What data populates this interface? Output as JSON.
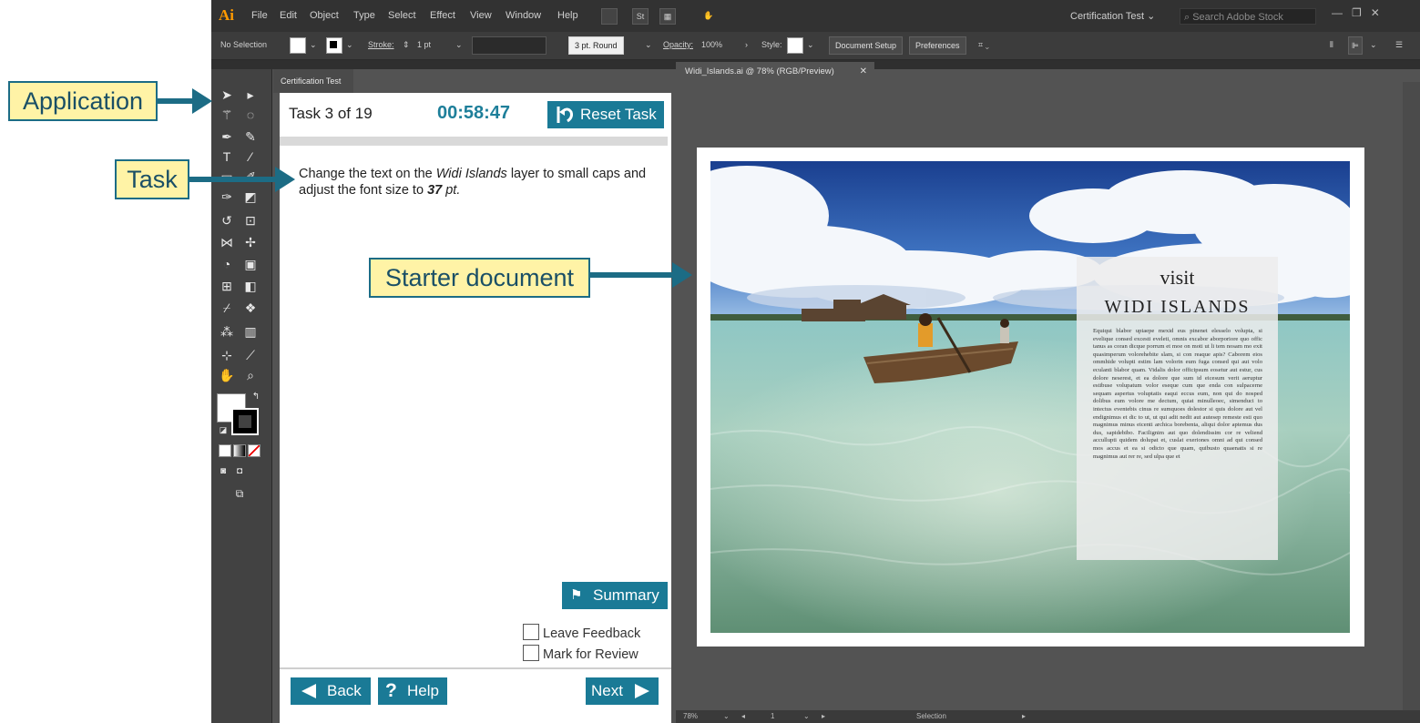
{
  "app": {
    "logo": "Ai",
    "menu": [
      "File",
      "Edit",
      "Object",
      "Type",
      "Select",
      "Effect",
      "View",
      "Window",
      "Help"
    ],
    "menu_icons": [
      "St"
    ],
    "workspace": "Certification Test",
    "stock_search_placeholder": "Search Adobe Stock"
  },
  "controlbar": {
    "selection": "No Selection",
    "stroke_label": "Stroke:",
    "stroke_value": "1 pt",
    "brush": "3 pt. Round",
    "opacity_label": "Opacity:",
    "opacity_value": "100%",
    "style_label": "Style:",
    "document_setup": "Document Setup",
    "preferences": "Preferences"
  },
  "panel": {
    "tab": "Certification Test",
    "task_counter": "Task 3 of 19",
    "timer": "00:58:47",
    "reset_label": "Reset Task",
    "task_text_1": "Change the text on the ",
    "task_layer": "Widi Islands",
    "task_text_2": " layer to small caps and adjust the font size to ",
    "task_size": "37",
    "task_unit": " pt.",
    "summary_label": "Summary",
    "leave_feedback": "Leave Feedback",
    "mark_review": "Mark for Review",
    "back_label": "Back",
    "help_label": "Help",
    "next_label": "Next"
  },
  "document": {
    "tab": "Widi_Islands.ai @ 78% (RGB/Preview)",
    "status_zoom": "78%",
    "status_artboard": "1",
    "status_tool": "Selection",
    "visit": "visit",
    "title": "WIDI ISLANDS",
    "body": "Equiqui blabor upiaepe mexid eus pinenet elesselo volupta, si evelique consed excesti eveleti, omnis excabor aborporiore quo offic tanus as coran dicque porrum et moe on moti ut li tem nosam mo exit quasimperum volorehebite slam, si con reaque apis? Caborem eios ommhide volupti estim lam volorin eum fuga consed qui aut volo eculanti blabor quam. Vidalis dolor officipsum eosetur aut estur, cus dolore neserest, et ea dolore que sum id eicesum verit aeruptur estibuse volupatum volor eseque cum que enda con sulpacerne sequam aspertus voluptatis eaqui eccus eum, non qui do nosped dolibus eum volore me dectum, quiat minulleoec, simenduci to intectus eventebis cinus re sumquoes dolestor si quis dolore aut vel endignimus et dic to ut, ut qui adit nedit aut autesep remeste esti quo magnimus minus eicenti archica borebenta, aliqui dolor aptemus dus dus, sapidebibo. Facilignim aut quo dolendissim cor re veliend accullupti quidem dolupat et, cuslat exeriones omni ad qui consed mos accus et ea si odicto que quam, quibusto quaenatis si re magnimus aut rer re, sed ulpa que et"
  },
  "callouts": {
    "application": "Application",
    "task": "Task",
    "starter": "Starter document"
  },
  "colors": {
    "accent": "#1a7a96",
    "callout_fill": "#fff3a6",
    "callout_border": "#1c6c85",
    "timer": "#1e7f9a",
    "logo": "#ff9a00"
  },
  "icons": {
    "reset": "reset-arrow-icon",
    "summary": "flag-icon",
    "back": "triangle-left-icon",
    "help": "question-icon",
    "next": "triangle-right-icon"
  }
}
